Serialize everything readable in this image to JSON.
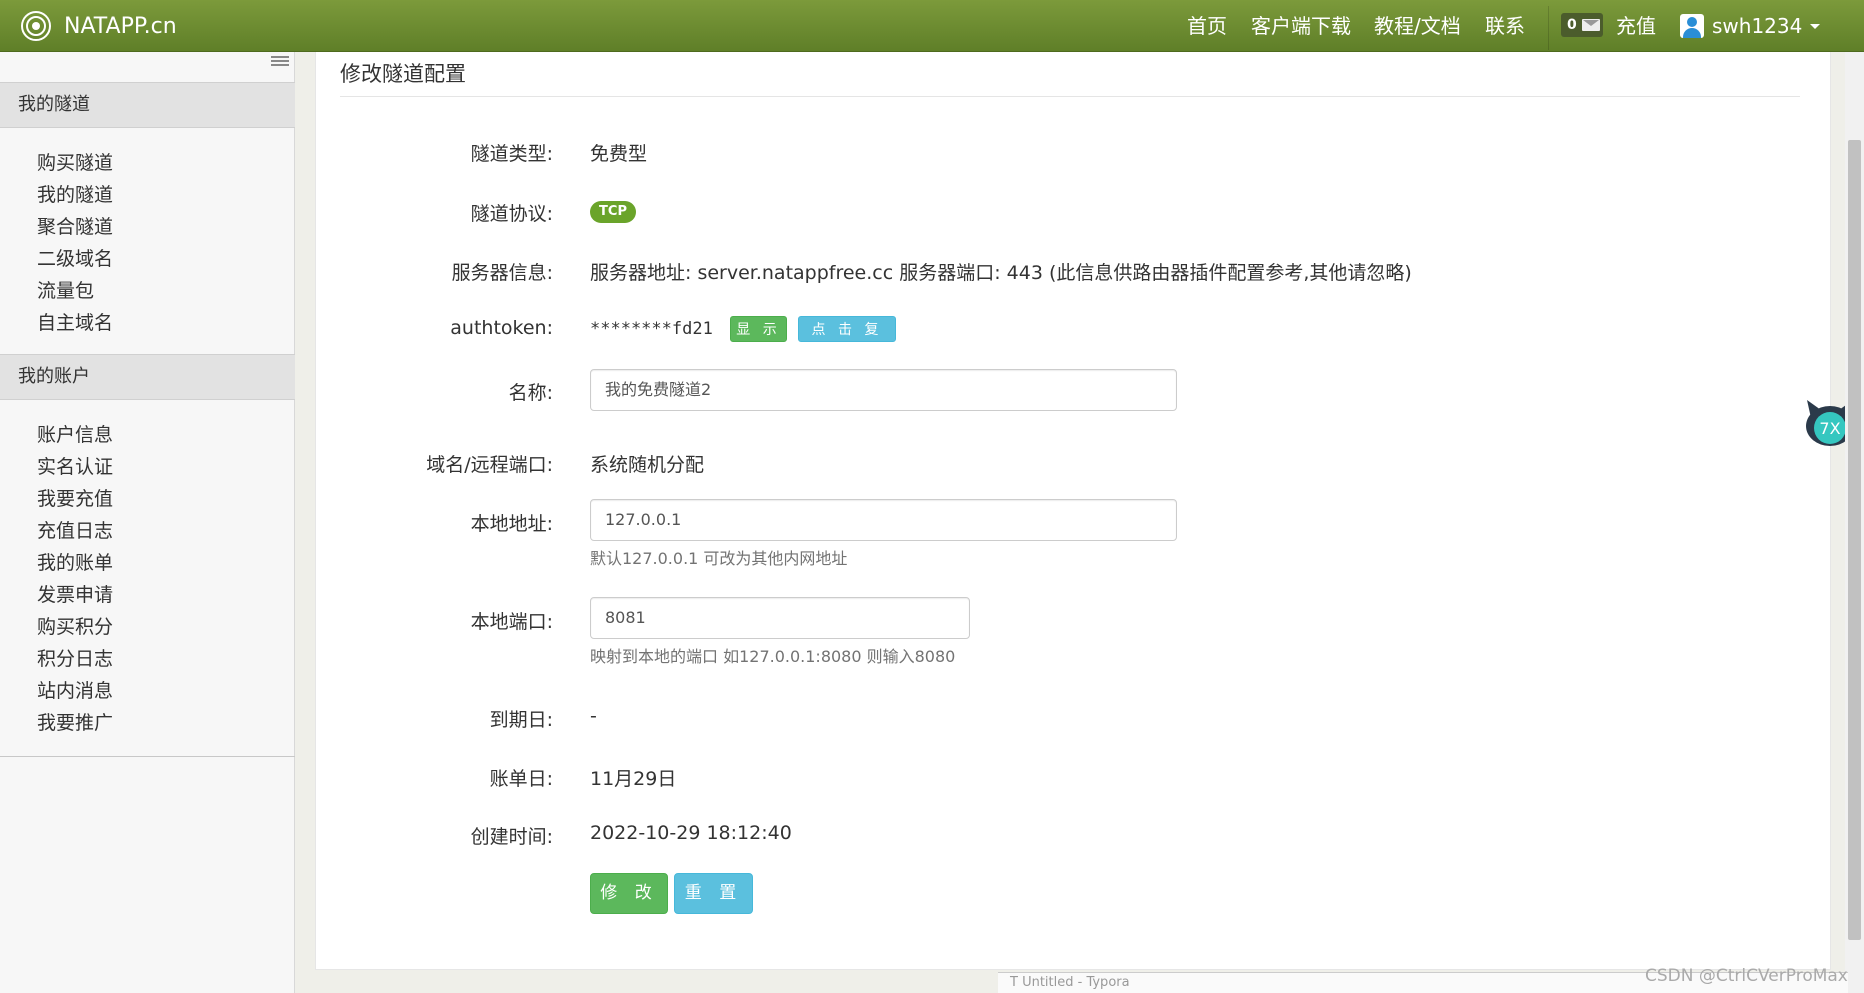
{
  "topbar": {
    "brand": "NATAPP.cn",
    "nav": [
      "首页",
      "客户端下载",
      "教程/文档",
      "联系"
    ],
    "mail_count": "0",
    "recharge": "充值",
    "username": "swh1234"
  },
  "sidebar": {
    "section1_title": "我的隧道",
    "section1_items": [
      "购买隧道",
      "我的隧道",
      "聚合隧道",
      "二级域名",
      "流量包",
      "自主域名"
    ],
    "section2_title": "我的账户",
    "section2_items": [
      "账户信息",
      "实名认证",
      "我要充值",
      "充值日志",
      "我的账单",
      "发票申请",
      "购买积分",
      "积分日志",
      "站内消息",
      "我要推广"
    ]
  },
  "form": {
    "title": "修改隧道配置",
    "tunnel_type_label": "隧道类型:",
    "tunnel_type_value": "免费型",
    "protocol_label": "隧道协议:",
    "protocol_value": "TCP",
    "server_label": "服务器信息:",
    "server_value": "服务器地址: server.natappfree.cc 服务器端口: 443 (此信息供路由器插件配置参考,其他请忽略)",
    "authtoken_label": "authtoken:",
    "authtoken_value": "********fd21",
    "show_button": "显 示",
    "copy_button": "点 击 复 制",
    "name_label": "名称:",
    "name_value": "我的免费隧道2",
    "domain_label": "域名/远程端口:",
    "domain_value": "系统随机分配",
    "local_addr_label": "本地地址:",
    "local_addr_value": "127.0.0.1",
    "local_addr_help": "默认127.0.0.1 可改为其他内网地址",
    "local_port_label": "本地端口:",
    "local_port_value": "8081",
    "local_port_help": "映射到本地的端口 如127.0.0.1:8080 则输入8080",
    "expire_label": "到期日:",
    "expire_value": "-",
    "bill_label": "账单日:",
    "bill_value": "11月29日",
    "created_label": "创建时间:",
    "created_value": "2022-10-29 18:12:40",
    "submit_button": "修 改",
    "reset_button": "重 置"
  },
  "overlay": {
    "taskbar_text": "T  Untitled - Typora",
    "watermark": "CSDN @CtrlCVerProMax"
  }
}
